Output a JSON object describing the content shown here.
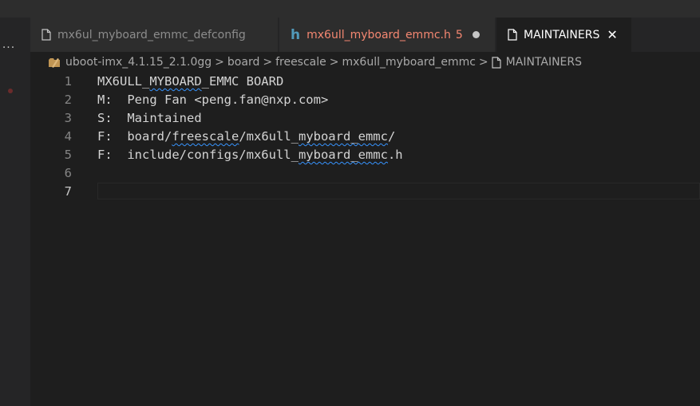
{
  "activity": {
    "more_icon": "ellipsis-icon",
    "more_glyph": "···"
  },
  "tabs": [
    {
      "label": "mx6ul_myboard_emmc_defconfig",
      "icon": "file-icon"
    },
    {
      "label": "mx6ull_myboard_emmc.h",
      "icon": "c-header-icon",
      "icon_glyph": "h",
      "problems": "5",
      "modified": true,
      "color": "#f48771"
    },
    {
      "label": "MAINTAINERS",
      "icon": "file-icon",
      "active": true,
      "close_glyph": "✕"
    }
  ],
  "breadcrumb": {
    "items": [
      "uboot-imx_4.1.15_2.1.0gg",
      "board",
      "freescale",
      "mx6ull_myboard_emmc",
      "MAINTAINERS"
    ],
    "separator": ">"
  },
  "editor": {
    "lines": [
      {
        "n": "1",
        "text": "MX6ULL_MYBOARD_EMMC BOARD"
      },
      {
        "n": "2",
        "text": "M:  Peng Fan <peng.fan@nxp.com>"
      },
      {
        "n": "3",
        "text": "S:  Maintained"
      },
      {
        "n": "4",
        "text": "F:  board/freescale/mx6ull_myboard_emmc/"
      },
      {
        "n": "5",
        "text": "F:  include/configs/mx6ull_myboard_emmc.h"
      },
      {
        "n": "6",
        "text": ""
      },
      {
        "n": "7",
        "text": ""
      }
    ],
    "active_line": "7"
  },
  "colors": {
    "background": "#1e1e1e",
    "tab_bar": "#252526",
    "error_text": "#f48771",
    "squiggle": "#3794ff"
  }
}
